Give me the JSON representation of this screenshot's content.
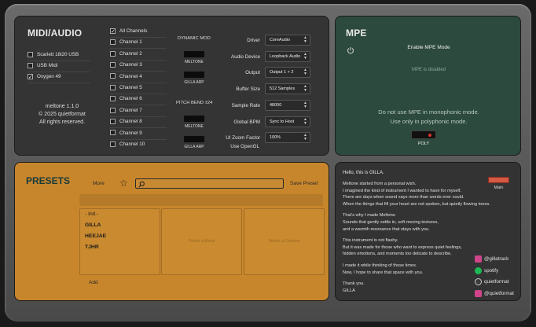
{
  "midi": {
    "title": "MIDI/AUDIO",
    "devices": [
      {
        "label": "Scarlett 18i20 USB",
        "checked": false
      },
      {
        "label": "USB Midi",
        "checked": false
      },
      {
        "label": "Oxygen 49",
        "checked": true
      }
    ],
    "channels": [
      {
        "label": "All Channels",
        "checked": true
      },
      {
        "label": "Channel 1",
        "checked": false
      },
      {
        "label": "Channel 2",
        "checked": false
      },
      {
        "label": "Channel 3",
        "checked": false
      },
      {
        "label": "Channel 4",
        "checked": false
      },
      {
        "label": "Channel 5",
        "checked": false
      },
      {
        "label": "Channel 6",
        "checked": false
      },
      {
        "label": "Channel 7",
        "checked": false
      },
      {
        "label": "Channel 8",
        "checked": false
      },
      {
        "label": "Channel 9",
        "checked": false
      },
      {
        "label": "Channel 10",
        "checked": false
      }
    ],
    "version": "meltone 1.1.0",
    "copyright": "© 2025 quietformat",
    "rights": "All rights reserved.",
    "dynamic_mod": "DYNAMIC MOD",
    "pitch_bend": "PITCH BEND ±24",
    "meltone_1": "MELTONE",
    "gilla_arp_1": "GILLA ARP",
    "meltone_2": "MELTONE",
    "gilla_arp_2": "GILLA ARP",
    "settings": [
      {
        "label": "Driver",
        "value": "CoreAudio"
      },
      {
        "label": "Audio Device",
        "value": "Loopback Audio"
      },
      {
        "label": "Output",
        "value": "Output 1 + 2"
      },
      {
        "label": "Buffer Size",
        "value": "512 Samples"
      },
      {
        "label": "Sample Rate",
        "value": "48000"
      },
      {
        "label": "Global BPM",
        "value": "Sync to Host"
      },
      {
        "label": "UI Zoom Factor",
        "value": "100%"
      }
    ],
    "opengl": "Use OpenGL"
  },
  "mpe": {
    "title": "MPE",
    "enable": "Enable MPE Mode",
    "disabled": "MPE is disabled",
    "note1": "Do not use MPE in monophonic mode.",
    "note2": "Use only in polyphonic mode.",
    "poly": "POLY",
    "power_icon": "power-icon"
  },
  "presets": {
    "title": "PRESETS",
    "more": "More",
    "save": "Save Preset",
    "search_placeholder": "",
    "items": [
      "- Init -",
      "GILLA",
      "HEEJAE",
      "TJHR"
    ],
    "bank_hint": "Select a Bank",
    "column_hint": "Select a Column",
    "add": "Add"
  },
  "about": {
    "greeting": "Hello, this is GILLA.",
    "main": "Main",
    "paragraphs": [
      [
        "Meltone started from a personal wish.",
        "I imagined the kind of instrument I wanted to have for myself.",
        "There are days when sound says more than words ever could.",
        "When the things that fill your heart are not spoken, but quietly flowing tones."
      ],
      [
        "That's why I made Meltone.",
        "Sounds that gently settle in, soft moving textures,",
        "and a warmth resonance that stays with you."
      ],
      [
        "This instrument is not flashy.",
        "But it was made for those who want to express quiet feelings,",
        "hidden emotions, and moments too delicate to describe."
      ],
      [
        "I made it while thinking of those times.",
        "Now, I hope to share that space with you."
      ],
      [
        "Thank you.",
        "GILLA"
      ]
    ],
    "social": [
      {
        "label": "@gillatrack",
        "color": "#d1448c"
      },
      {
        "label": "spotify",
        "color": "#1db954"
      },
      {
        "label": "quietformat",
        "color": "#3a3a3a"
      },
      {
        "label": "@quietformat",
        "color": "#d1448c"
      }
    ]
  }
}
